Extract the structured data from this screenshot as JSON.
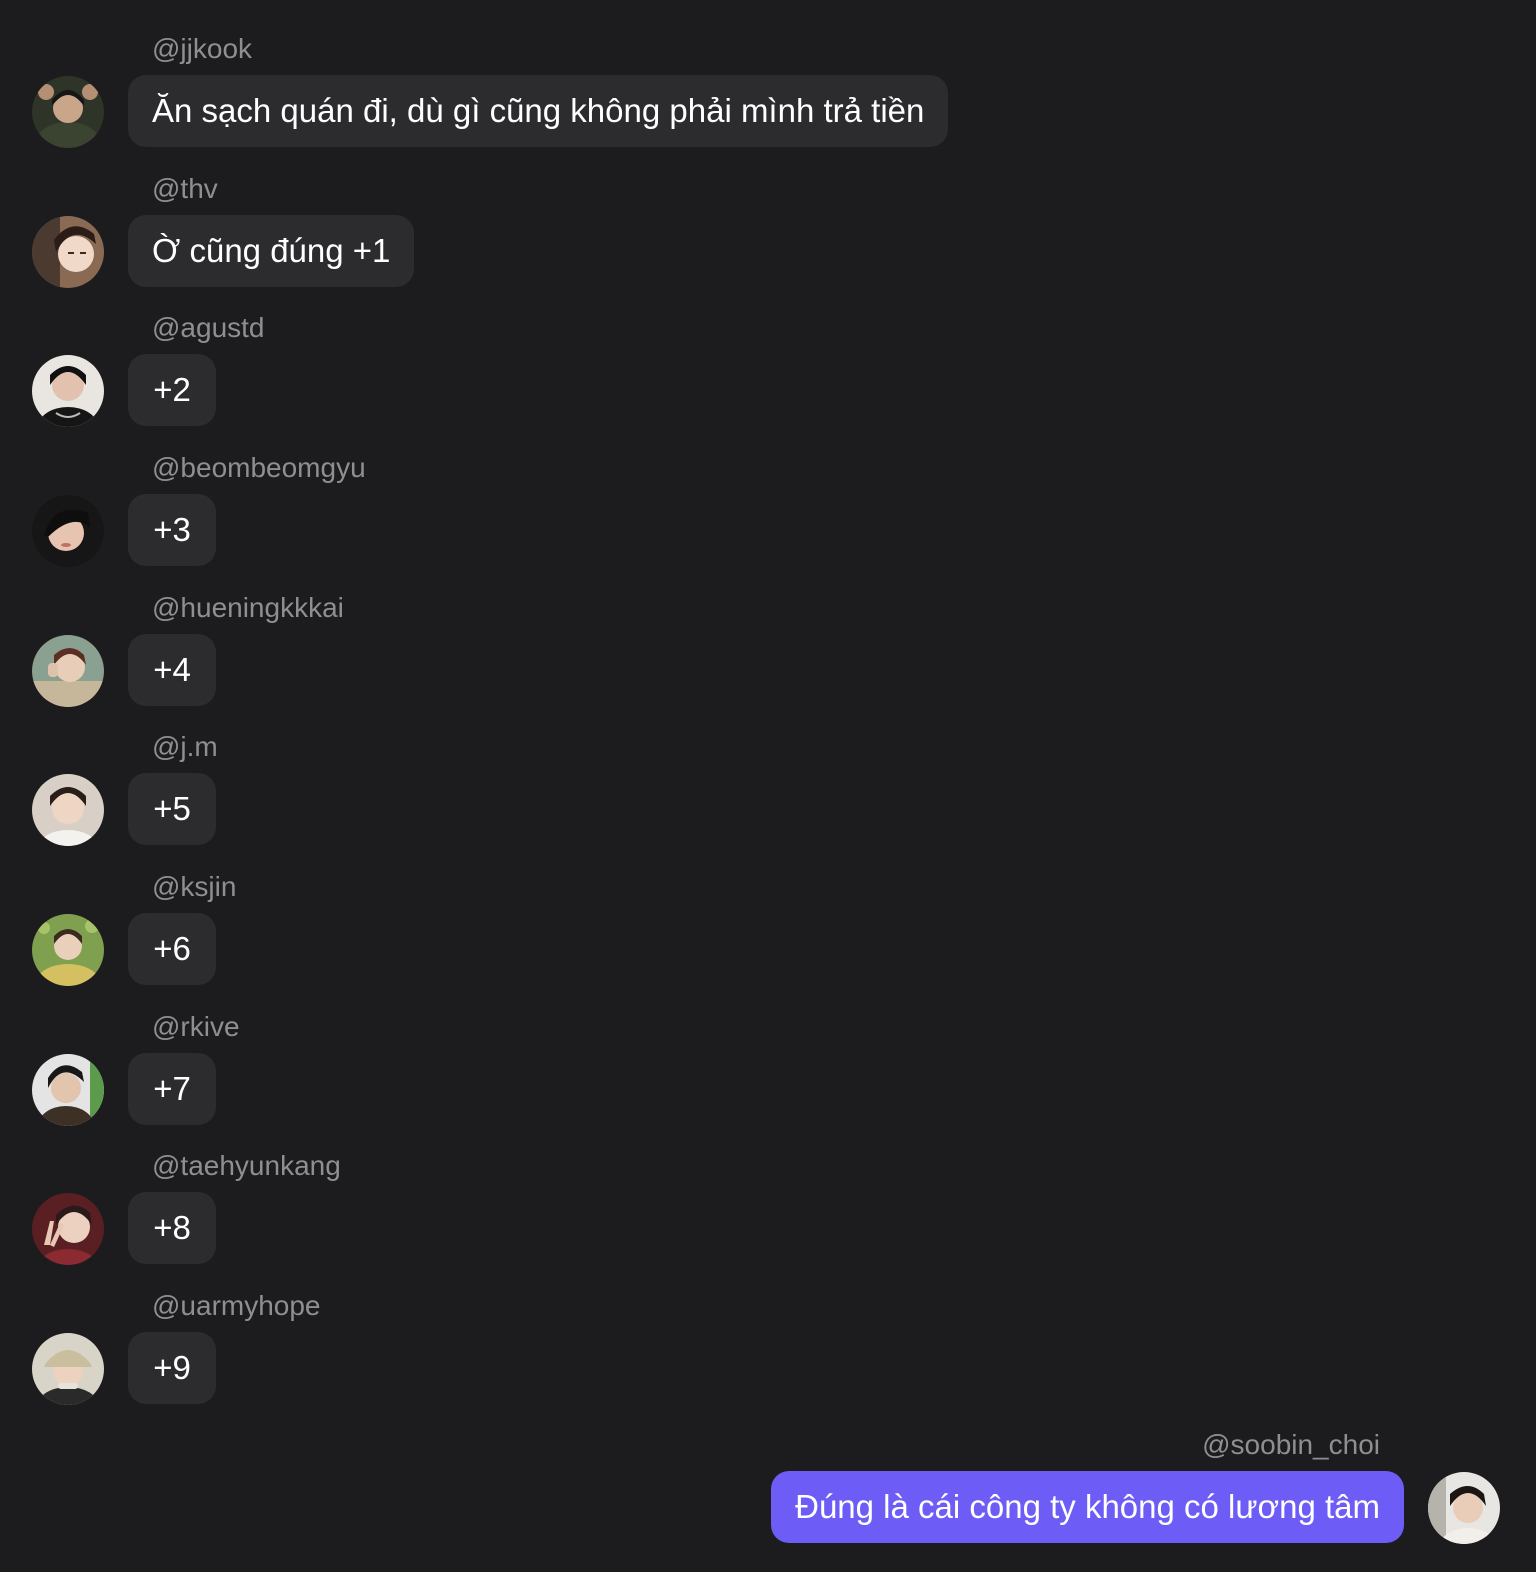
{
  "colors": {
    "background": "#1c1c1e",
    "incoming_bubble": "#2c2c2e",
    "outgoing_bubble": "#6e5cf6",
    "username_text": "#8e8e93",
    "message_text": "#ffffff"
  },
  "messages": [
    {
      "user": "@jjkook",
      "text": "Ăn sạch quán đi, dù gì cũng không phải mình trả tiền",
      "direction": "incoming",
      "avatar": "avatar-jjkook"
    },
    {
      "user": "@thv",
      "text": "Ờ cũng đúng +1",
      "direction": "incoming",
      "avatar": "avatar-thv"
    },
    {
      "user": "@agustd",
      "text": "+2",
      "direction": "incoming",
      "avatar": "avatar-agustd"
    },
    {
      "user": "@beombeomgyu",
      "text": "+3",
      "direction": "incoming",
      "avatar": "avatar-beombeomgyu"
    },
    {
      "user": "@hueningkkkai",
      "text": "+4",
      "direction": "incoming",
      "avatar": "avatar-hueningkkkai"
    },
    {
      "user": "@j.m",
      "text": "+5",
      "direction": "incoming",
      "avatar": "avatar-jm"
    },
    {
      "user": "@ksjin",
      "text": "+6",
      "direction": "incoming",
      "avatar": "avatar-ksjin"
    },
    {
      "user": "@rkive",
      "text": "+7",
      "direction": "incoming",
      "avatar": "avatar-rkive"
    },
    {
      "user": "@taehyunkang",
      "text": "+8",
      "direction": "incoming",
      "avatar": "avatar-taehyunkang"
    },
    {
      "user": "@uarmyhope",
      "text": "+9",
      "direction": "incoming",
      "avatar": "avatar-uarmyhope"
    },
    {
      "user": "@soobin_choi",
      "text": "Đúng là cái công ty không có lương tâm",
      "direction": "outgoing",
      "avatar": "avatar-soobin-choi"
    }
  ]
}
